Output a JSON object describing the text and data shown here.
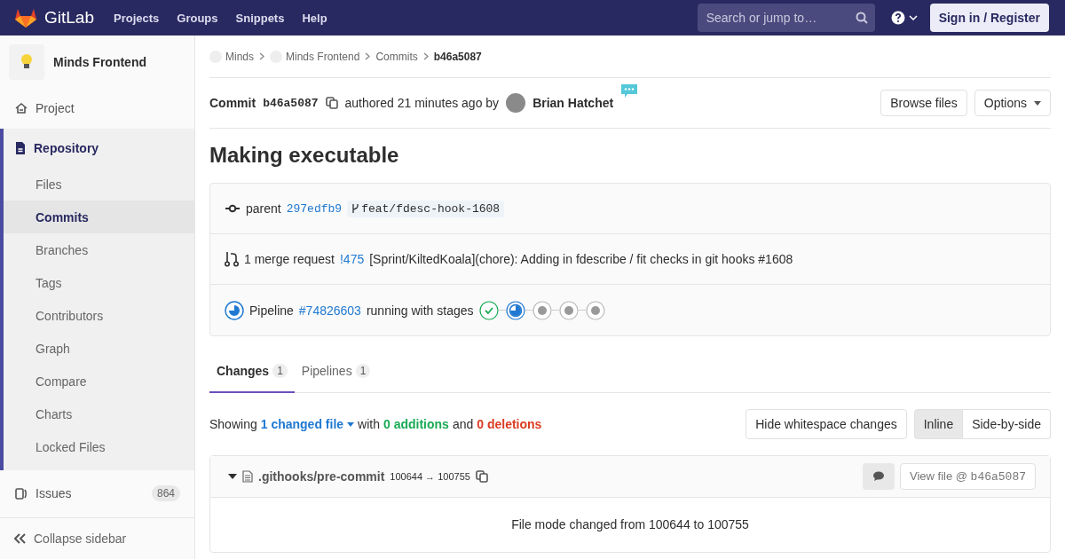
{
  "navbar": {
    "brand": "GitLab",
    "links": [
      "Projects",
      "Groups",
      "Snippets",
      "Help"
    ],
    "search": {
      "placeholder": "Search or jump to…"
    },
    "sign_in": "Sign in / Register"
  },
  "sidebar": {
    "project": "Minds Frontend",
    "items": [
      {
        "kind": "link",
        "label": "Project",
        "selected": false
      },
      {
        "kind": "section",
        "label": "Repository",
        "selected": true,
        "children": [
          {
            "label": "Files",
            "selected": false
          },
          {
            "label": "Commits",
            "selected": true
          },
          {
            "label": "Branches",
            "selected": false
          },
          {
            "label": "Tags",
            "selected": false
          },
          {
            "label": "Contributors",
            "selected": false
          },
          {
            "label": "Graph",
            "selected": false
          },
          {
            "label": "Compare",
            "selected": false
          },
          {
            "label": "Charts",
            "selected": false
          },
          {
            "label": "Locked Files",
            "selected": false
          }
        ]
      },
      {
        "kind": "link",
        "label": "Issues",
        "count": "864",
        "selected": false
      }
    ],
    "collapse": "Collapse sidebar"
  },
  "breadcrumbs": [
    {
      "label": "Minds",
      "kind": "project"
    },
    {
      "label": "Minds Frontend",
      "kind": "project"
    },
    {
      "label": "Commits",
      "kind": "page"
    },
    {
      "label": "b46a5087",
      "kind": "page"
    }
  ],
  "commit": {
    "label": "Commit",
    "sha": "b46a5087",
    "authored": "authored 21 minutes ago by",
    "author": "Brian Hatchet",
    "buttons": [
      "Browse files",
      "Options"
    ],
    "title": "Making executable"
  },
  "info": {
    "parent": {
      "label": "parent",
      "sha": "297edfb9",
      "branch": "feat/fdesc-hook-1608"
    },
    "merge_request": {
      "label": "1 merge request",
      "ref": "!475",
      "title": "[Sprint/KiltedKoala](chore): Adding in fdescribe / fit checks in git hooks #1608"
    },
    "pipeline": {
      "label": "Pipeline",
      "ref": "#74826603",
      "status_text": "running with stages",
      "stages": [
        {
          "kind": "success"
        },
        {
          "kind": "running"
        },
        {
          "kind": "created"
        },
        {
          "kind": "created"
        },
        {
          "kind": "created"
        }
      ]
    }
  },
  "tabs": [
    {
      "label": "Changes",
      "count": "1",
      "selected": true
    },
    {
      "label": "Pipelines",
      "count": "1",
      "selected": false
    }
  ],
  "summary": {
    "showing": "Showing",
    "files": "1 changed file",
    "with": "with",
    "additions": "0 additions",
    "and": "and",
    "deletions": "0 deletions"
  },
  "whitespace_button": "Hide whitespace changes",
  "view_modes": [
    {
      "label": "Inline",
      "selected": true
    },
    {
      "label": "Side-by-side",
      "selected": false
    }
  ],
  "file": {
    "expanded": true,
    "path": ".githooks/pre-commit",
    "mode": "100644 → 100755",
    "view_button": "View file @ ",
    "view_sha": "b46a5087",
    "message": "File mode changed from 100644 to 100755"
  }
}
